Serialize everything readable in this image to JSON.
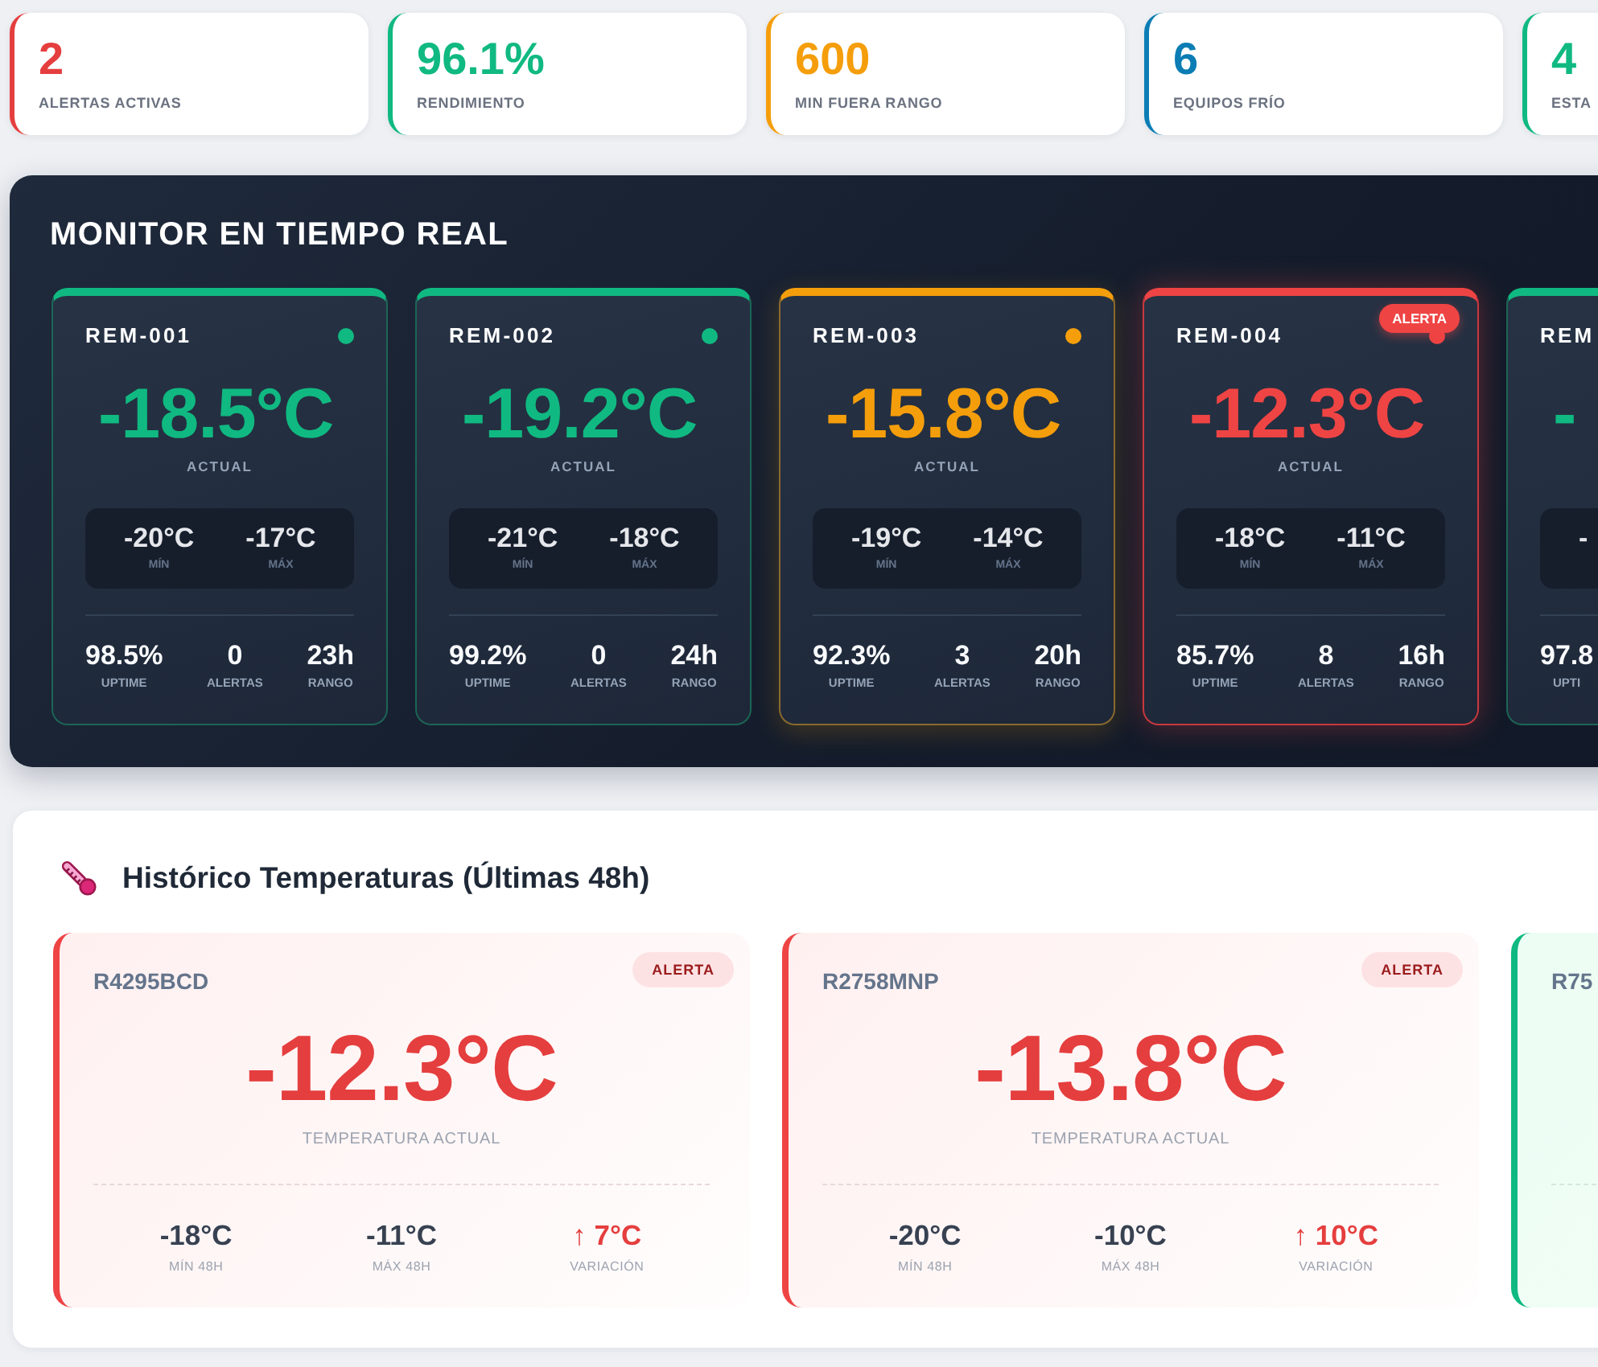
{
  "stats": [
    {
      "value": "2",
      "label": "ALERTAS ACTIVAS",
      "color": "#e53e3e"
    },
    {
      "value": "96.1%",
      "label": "RENDIMIENTO",
      "color": "#10b981"
    },
    {
      "value": "600",
      "label": "MIN FUERA RANGO",
      "color": "#f59e0b"
    },
    {
      "value": "6",
      "label": "EQUIPOS FRÍO",
      "color": "#0b7db4"
    },
    {
      "value": "4",
      "label": "ESTA",
      "color": "#10b981"
    }
  ],
  "monitor": {
    "title": "MONITOR EN TIEMPO REAL",
    "units": [
      {
        "name": "REM-001",
        "kind": "normal",
        "temperature": "-18.5°C",
        "temperature_label": "ACTUAL",
        "range": [
          {
            "value": "-20°C",
            "label": "MÍN"
          },
          {
            "value": "-17°C",
            "label": "MÁX"
          }
        ],
        "metrics": [
          {
            "value": "98.5%",
            "label": "UPTIME"
          },
          {
            "value": "0",
            "label": "ALERTAS"
          },
          {
            "value": "23h",
            "label": "RANGO"
          }
        ]
      },
      {
        "name": "REM-002",
        "kind": "normal",
        "temperature": "-19.2°C",
        "temperature_label": "ACTUAL",
        "range": [
          {
            "value": "-21°C",
            "label": "MÍN"
          },
          {
            "value": "-18°C",
            "label": "MÁX"
          }
        ],
        "metrics": [
          {
            "value": "99.2%",
            "label": "UPTIME"
          },
          {
            "value": "0",
            "label": "ALERTAS"
          },
          {
            "value": "24h",
            "label": "RANGO"
          }
        ]
      },
      {
        "name": "REM-003",
        "kind": "warning",
        "temperature": "-15.8°C",
        "temperature_label": "ACTUAL",
        "range": [
          {
            "value": "-19°C",
            "label": "MÍN"
          },
          {
            "value": "-14°C",
            "label": "MÁX"
          }
        ],
        "metrics": [
          {
            "value": "92.3%",
            "label": "UPTIME"
          },
          {
            "value": "3",
            "label": "ALERTAS"
          },
          {
            "value": "20h",
            "label": "RANGO"
          }
        ]
      },
      {
        "name": "REM-004",
        "kind": "alert",
        "badge": "ALERTA",
        "temperature": "-12.3°C",
        "temperature_label": "ACTUAL",
        "range": [
          {
            "value": "-18°C",
            "label": "MÍN"
          },
          {
            "value": "-11°C",
            "label": "MÁX"
          }
        ],
        "metrics": [
          {
            "value": "85.7%",
            "label": "UPTIME"
          },
          {
            "value": "8",
            "label": "ALERTAS"
          },
          {
            "value": "16h",
            "label": "RANGO"
          }
        ]
      },
      {
        "name": "REM",
        "kind": "normal",
        "temperature": "-",
        "range": [
          {
            "value": "-"
          }
        ],
        "metrics": [
          {
            "value": "97.8",
            "label": "UPTI"
          }
        ]
      }
    ]
  },
  "history": {
    "title": "Histórico Temperaturas (Últimas 48h)",
    "cards": [
      {
        "id": "R4295BCD",
        "kind": "alert",
        "badge": "ALERTA",
        "temperature": "-12.3°C",
        "temperature_label": "TEMPERATURA ACTUAL",
        "stats": [
          {
            "kind": "value",
            "value": "-18°C",
            "label": "MÍN 48H"
          },
          {
            "kind": "value",
            "value": "-11°C",
            "label": "MÁX 48H"
          },
          {
            "kind": "variation",
            "value": "↑ 7°C",
            "label": "VARIACIÓN"
          }
        ]
      },
      {
        "id": "R2758MNP",
        "kind": "alert",
        "badge": "ALERTA",
        "temperature": "-13.8°C",
        "temperature_label": "TEMPERATURA ACTUAL",
        "stats": [
          {
            "kind": "value",
            "value": "-20°C",
            "label": "MÍN 48H"
          },
          {
            "kind": "value",
            "value": "-10°C",
            "label": "MÁX 48H"
          },
          {
            "kind": "variation",
            "value": "↑ 10°C",
            "label": "VARIACIÓN"
          }
        ]
      },
      {
        "id": "R75",
        "kind": "normal"
      }
    ]
  }
}
